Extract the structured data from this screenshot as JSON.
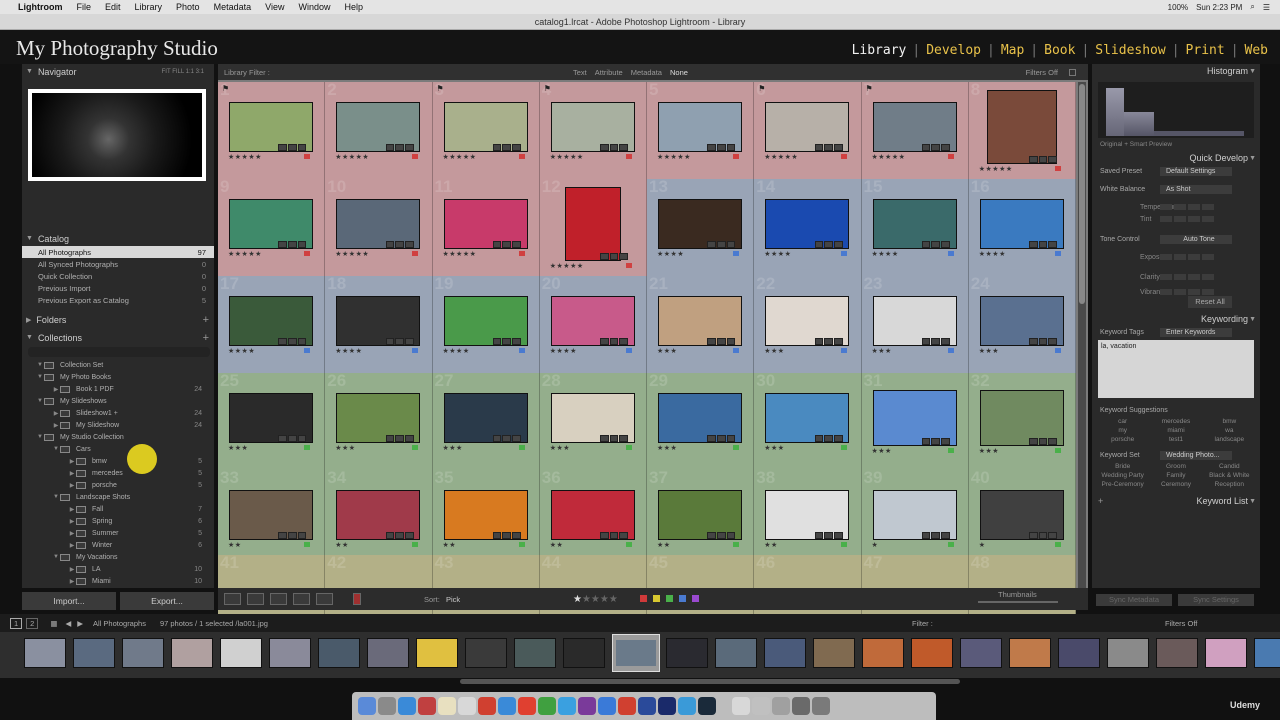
{
  "mac_menu": {
    "app": "Lightroom",
    "items": [
      "File",
      "Edit",
      "Library",
      "Photo",
      "Metadata",
      "View",
      "Window",
      "Help"
    ],
    "battery": "100%",
    "clock": "Sun 2:23 PM"
  },
  "window_title": "catalog1.lrcat - Adobe Photoshop Lightroom - Library",
  "identity": {
    "studio_name": "My Photography Studio",
    "modules": [
      "Library",
      "Develop",
      "Map",
      "Book",
      "Slideshow",
      "Print",
      "Web"
    ],
    "active_module": "Library"
  },
  "left_panel": {
    "navigator": {
      "title": "Navigator",
      "zoom_options": "FIT  FILL  1:1  3:1"
    },
    "catalog": {
      "title": "Catalog",
      "items": [
        {
          "label": "All Photographs",
          "count": "97"
        },
        {
          "label": "All Synced Photographs",
          "count": "0"
        },
        {
          "label": "Quick Collection",
          "count": "0"
        },
        {
          "label": "Previous Import",
          "count": "0"
        },
        {
          "label": "Previous Export as Catalog",
          "count": "5"
        }
      ]
    },
    "folders": {
      "title": "Folders"
    },
    "collections": {
      "title": "Collections",
      "items": [
        {
          "label": "Collection Set",
          "count": "",
          "depth": 1
        },
        {
          "label": "My Photo Books",
          "count": "",
          "depth": 1
        },
        {
          "label": "Book 1 PDF",
          "count": "24",
          "depth": 2
        },
        {
          "label": "My Slideshows",
          "count": "",
          "depth": 1
        },
        {
          "label": "Slideshow1 +",
          "count": "24",
          "depth": 2
        },
        {
          "label": "My Slideshow",
          "count": "24",
          "depth": 2
        },
        {
          "label": "My Studio Collection",
          "count": "",
          "depth": 1
        },
        {
          "label": "Cars",
          "count": "",
          "depth": 2
        },
        {
          "label": "bmw",
          "count": "5",
          "depth": 3
        },
        {
          "label": "mercedes",
          "count": "5",
          "depth": 3
        },
        {
          "label": "porsche",
          "count": "5",
          "depth": 3
        },
        {
          "label": "Landscape Shots",
          "count": "",
          "depth": 2
        },
        {
          "label": "Fall",
          "count": "7",
          "depth": 3
        },
        {
          "label": "Spring",
          "count": "6",
          "depth": 3
        },
        {
          "label": "Summer",
          "count": "5",
          "depth": 3
        },
        {
          "label": "Winter",
          "count": "6",
          "depth": 3
        },
        {
          "label": "My Vacations",
          "count": "",
          "depth": 2
        },
        {
          "label": "LA",
          "count": "10",
          "depth": 3
        },
        {
          "label": "Miami",
          "count": "10",
          "depth": 3
        }
      ]
    },
    "import_label": "Import...",
    "export_label": "Export..."
  },
  "filter_bar": {
    "label": "Library Filter :",
    "options": [
      "Text",
      "Attribute",
      "Metadata",
      "None"
    ],
    "active": "None",
    "filters_off": "Filters Off"
  },
  "grid": {
    "cells": [
      {
        "n": "1",
        "stars": "★★★★★",
        "bg": "#c4999c",
        "img": "#8fa86a",
        "label": "#d04040",
        "flag": true
      },
      {
        "n": "2",
        "stars": "★★★★★",
        "bg": "#c4999c",
        "img": "#7a8f8a",
        "label": "#d04040",
        "flag": false
      },
      {
        "n": "3",
        "stars": "★★★★★",
        "bg": "#c4999c",
        "img": "#a9b08c",
        "label": "#d04040",
        "flag": true
      },
      {
        "n": "4",
        "stars": "★★★★★",
        "bg": "#c4999c",
        "img": "#a8b0a0",
        "label": "#d04040",
        "flag": true
      },
      {
        "n": "5",
        "stars": "★★★★★",
        "bg": "#c4999c",
        "img": "#8fa0b0",
        "label": "#d04040",
        "flag": false
      },
      {
        "n": "6",
        "stars": "★★★★★",
        "bg": "#c4999c",
        "img": "#b7b0a8",
        "label": "#d04040",
        "flag": true
      },
      {
        "n": "7",
        "stars": "★★★★★",
        "bg": "#c4999c",
        "img": "#707d88",
        "label": "#d04040",
        "flag": true
      },
      {
        "n": "8",
        "stars": "★★★★★",
        "bg": "#c4999c",
        "img": "#7a4a3a",
        "label": "#d04040",
        "flag": false
      },
      {
        "n": "9",
        "stars": "★★★★★",
        "bg": "#c4999c",
        "img": "#3f8a6a",
        "label": "#d04040",
        "flag": false
      },
      {
        "n": "10",
        "stars": "★★★★★",
        "bg": "#c4999c",
        "img": "#5a6878",
        "label": "#d04040",
        "flag": false
      },
      {
        "n": "11",
        "stars": "★★★★★",
        "bg": "#c4999c",
        "img": "#c83a6a",
        "label": "#d04040",
        "flag": false
      },
      {
        "n": "12",
        "stars": "★★★★★",
        "bg": "#c4999c",
        "img": "#c0202a",
        "label": "#d04040",
        "flag": false
      },
      {
        "n": "13",
        "stars": "★★★★",
        "bg": "#99a4b6",
        "img": "#3a2a20",
        "label": "#4a7ad0",
        "flag": false
      },
      {
        "n": "14",
        "stars": "★★★★",
        "bg": "#99a4b6",
        "img": "#1a4ab0",
        "label": "#4a7ad0",
        "flag": false
      },
      {
        "n": "15",
        "stars": "★★★★",
        "bg": "#99a4b6",
        "img": "#3a6a6a",
        "label": "#4a7ad0",
        "flag": false
      },
      {
        "n": "16",
        "stars": "★★★★",
        "bg": "#99a4b6",
        "img": "#3a7ac0",
        "label": "#4a7ad0",
        "flag": false
      },
      {
        "n": "17",
        "stars": "★★★★",
        "bg": "#99a4b6",
        "img": "#3a5a3a",
        "label": "#4a7ad0",
        "flag": false
      },
      {
        "n": "18",
        "stars": "★★★★",
        "bg": "#99a4b6",
        "img": "#303030",
        "label": "#4a7ad0",
        "flag": false
      },
      {
        "n": "19",
        "stars": "★★★★",
        "bg": "#99a4b6",
        "img": "#4a9a4a",
        "label": "#4a7ad0",
        "flag": false
      },
      {
        "n": "20",
        "stars": "★★★★",
        "bg": "#99a4b6",
        "img": "#c85a8a",
        "label": "#4a7ad0",
        "flag": false
      },
      {
        "n": "21",
        "stars": "★★★",
        "bg": "#99a4b6",
        "img": "#c0a080",
        "label": "#4a7ad0",
        "flag": false
      },
      {
        "n": "22",
        "stars": "★★★",
        "bg": "#99a4b6",
        "img": "#e0d8d0",
        "label": "#4a7ad0",
        "flag": false
      },
      {
        "n": "23",
        "stars": "★★★",
        "bg": "#99a4b6",
        "img": "#d8d8d8",
        "label": "#4a7ad0",
        "flag": false
      },
      {
        "n": "24",
        "stars": "★★★",
        "bg": "#99a4b6",
        "img": "#5a7090",
        "label": "#4a7ad0",
        "flag": false
      },
      {
        "n": "25",
        "stars": "★★★",
        "bg": "#94ae8c",
        "img": "#2a2a2a",
        "label": "#4ab04a",
        "flag": false
      },
      {
        "n": "26",
        "stars": "★★★",
        "bg": "#94ae8c",
        "img": "#6a8a4a",
        "label": "#4ab04a",
        "flag": false
      },
      {
        "n": "27",
        "stars": "★★★",
        "bg": "#94ae8c",
        "img": "#2a3a4a",
        "label": "#4ab04a",
        "flag": false
      },
      {
        "n": "28",
        "stars": "★★★",
        "bg": "#94ae8c",
        "img": "#d8d0c0",
        "label": "#4ab04a",
        "flag": false
      },
      {
        "n": "29",
        "stars": "★★★",
        "bg": "#94ae8c",
        "img": "#3a6aa0",
        "label": "#4ab04a",
        "flag": false
      },
      {
        "n": "30",
        "stars": "★★★",
        "bg": "#94ae8c",
        "img": "#4a8ac0",
        "label": "#4ab04a",
        "flag": false
      },
      {
        "n": "31",
        "stars": "★★★",
        "bg": "#94ae8c",
        "img": "#5a8ad0",
        "label": "#4ab04a",
        "flag": false
      },
      {
        "n": "32",
        "stars": "★★★",
        "bg": "#94ae8c",
        "img": "#708a60",
        "label": "#4ab04a",
        "flag": false
      },
      {
        "n": "33",
        "stars": "★★",
        "bg": "#94ae8c",
        "img": "#6a5a4a",
        "label": "#4ab04a",
        "flag": false
      },
      {
        "n": "34",
        "stars": "★★",
        "bg": "#94ae8c",
        "img": "#a03a4a",
        "label": "#4ab04a",
        "flag": false
      },
      {
        "n": "35",
        "stars": "★★",
        "bg": "#94ae8c",
        "img": "#d87a20",
        "label": "#4ab04a",
        "flag": false
      },
      {
        "n": "36",
        "stars": "★★",
        "bg": "#94ae8c",
        "img": "#c02a3a",
        "label": "#4ab04a",
        "flag": false
      },
      {
        "n": "37",
        "stars": "★★",
        "bg": "#94ae8c",
        "img": "#5a7a3a",
        "label": "#4ab04a",
        "flag": false
      },
      {
        "n": "38",
        "stars": "★★",
        "bg": "#94ae8c",
        "img": "#e0e0e0",
        "label": "#4ab04a",
        "flag": false
      },
      {
        "n": "39",
        "stars": "★",
        "bg": "#94ae8c",
        "img": "#c0c8d0",
        "label": "#4ab04a",
        "flag": false
      },
      {
        "n": "40",
        "stars": "★",
        "bg": "#94ae8c",
        "img": "#404040",
        "label": "#4ab04a",
        "flag": false
      },
      {
        "n": "41",
        "stars": "",
        "bg": "#b3b087",
        "img": "",
        "label": "",
        "flag": false
      },
      {
        "n": "42",
        "stars": "",
        "bg": "#b3b087",
        "img": "",
        "label": "",
        "flag": false
      },
      {
        "n": "43",
        "stars": "",
        "bg": "#b3b087",
        "img": "",
        "label": "",
        "flag": false
      },
      {
        "n": "44",
        "stars": "",
        "bg": "#b3b087",
        "img": "",
        "label": "",
        "flag": false
      },
      {
        "n": "45",
        "stars": "",
        "bg": "#b3b087",
        "img": "",
        "label": "",
        "flag": false
      },
      {
        "n": "46",
        "stars": "",
        "bg": "#b3b087",
        "img": "",
        "label": "",
        "flag": false
      },
      {
        "n": "47",
        "stars": "",
        "bg": "#b3b087",
        "img": "",
        "label": "",
        "flag": false
      },
      {
        "n": "48",
        "stars": "",
        "bg": "#b3b087",
        "img": "",
        "label": "",
        "flag": false
      }
    ]
  },
  "toolbar": {
    "sort_label": "Sort:",
    "sort_value": "Pick",
    "thumbnails_label": "Thumbnails",
    "color_labels": [
      "#d03a3a",
      "#d8c830",
      "#4ab04a",
      "#4a7ad0",
      "#9a4ad0"
    ]
  },
  "right_panel": {
    "histogram": {
      "title": "Histogram",
      "caption": "Original + Smart Preview"
    },
    "quick_develop": {
      "title": "Quick Develop",
      "saved_preset_label": "Saved Preset",
      "saved_preset_value": "Default Settings",
      "white_balance_label": "White Balance",
      "white_balance_value": "As Shot",
      "temperature": "Temperature",
      "tint": "Tint",
      "tone_control_label": "Tone Control",
      "auto_tone": "Auto Tone",
      "exposure": "Exposure",
      "clarity": "Clarity",
      "vibrance": "Vibrance",
      "reset_all": "Reset All"
    },
    "keywording": {
      "title": "Keywording",
      "keyword_tags_label": "Keyword Tags",
      "keyword_tags_value": "Enter Keywords",
      "keywords_text": "la, vacation",
      "suggestions_label": "Keyword Suggestions",
      "suggestions": [
        "car",
        "mercedes",
        "bmw",
        "my",
        "miami",
        "wa",
        "porsche",
        "test1",
        "landscape"
      ],
      "keyword_set_label": "Keyword Set",
      "keyword_set_value": "Wedding Photo...",
      "set_items": [
        "Bride",
        "Groom",
        "Candid",
        "Wedding Party",
        "Family",
        "Black & White",
        "Pre-Ceremony",
        "Ceremony",
        "Reception"
      ]
    },
    "keyword_list": {
      "title": "Keyword List"
    },
    "sync_metadata": "Sync Metadata",
    "sync_settings": "Sync Settings"
  },
  "filmstrip_bar": {
    "source": "All Photographs",
    "status": "97 photos / 1 selected /la001.jpg",
    "filter_label": "Filter :",
    "filters_off": "Filters Off",
    "page_1": "1",
    "page_2": "2"
  },
  "filmstrip": {
    "thumbs": [
      "#8a90a0",
      "#5a6a80",
      "#707a8a",
      "#b0a0a0",
      "#d0d0d0",
      "#8a8a9a",
      "#4a5a6a",
      "#6a6a7a",
      "#e0c040",
      "#3a3a3a",
      "#4a5a5a",
      "#2a2a2a",
      "#6a7a8a",
      "#2a2a30",
      "#5a6a7a",
      "#4a5a7a",
      "#806a50",
      "#c06a3a",
      "#c05a2a",
      "#5a5a7a",
      "#c07a4a",
      "#4a4a6a",
      "#8a8a8a",
      "#6a5a5a",
      "#d0a0c0",
      "#4a7ab0"
    ]
  },
  "dock": {
    "apps": [
      "#5a8ad8",
      "#8a8a8a",
      "#3a8ad8",
      "#c04040",
      "#e8e0c0",
      "#d8d8d8",
      "#d04030",
      "#3a8ad8",
      "#e04030",
      "#40a040",
      "#3aa0e0",
      "#7a3a9a",
      "#3a7ad8",
      "#d04030",
      "#2a4a9a",
      "#1a2a6a",
      "#3a9ad8",
      "#1a2a3a",
      "#d8d8d8",
      "#c0c0c0",
      "#a0a0a0",
      "#6a6a6a",
      "#7a7a7a"
    ]
  },
  "watermark": "Udemy"
}
